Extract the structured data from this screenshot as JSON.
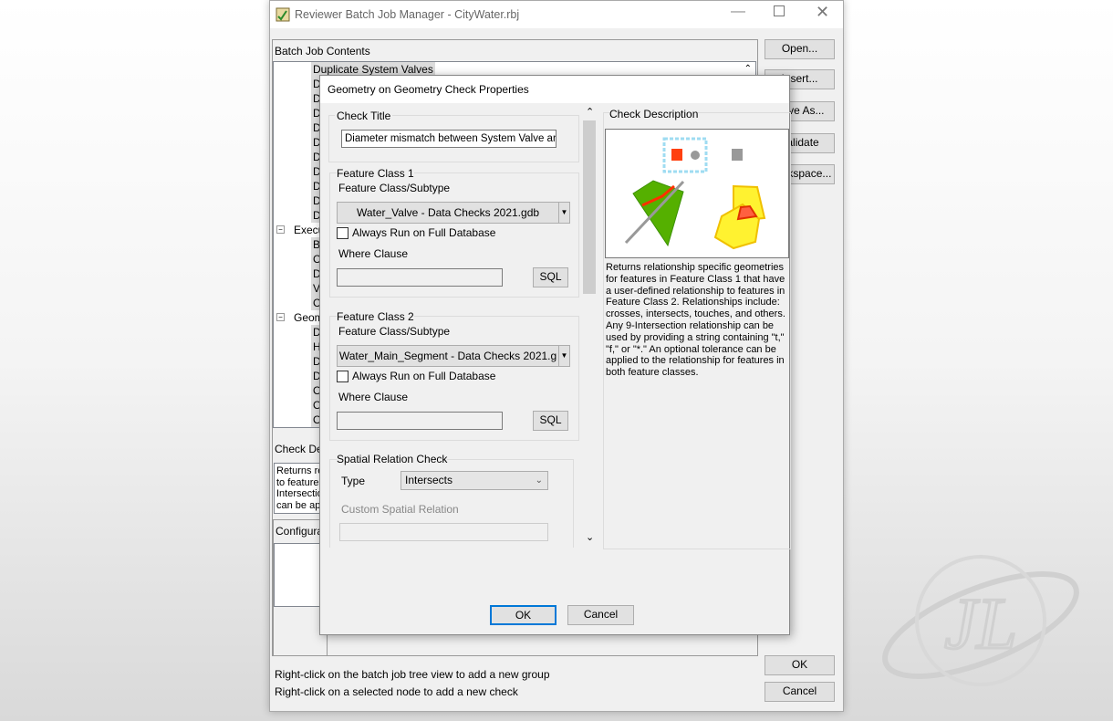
{
  "main_window": {
    "title": "Reviewer Batch Job Manager - CityWater.rbj",
    "batch_job_contents_label": "Batch Job Contents",
    "tree": {
      "selected": "Duplicate System Valves",
      "items": [
        "Du",
        "Du",
        "Du",
        "Du",
        "Du",
        "Du",
        "Du",
        "Du",
        "Du",
        "Du"
      ],
      "groups": [
        {
          "label": "Execu",
          "children": [
            "Bu",
            "Ci",
            "Di",
            "Va",
            "Cu"
          ]
        },
        {
          "label": "Geom",
          "children": [
            "De",
            "Hy",
            "Di",
            "Di",
            "Ov",
            "Ov",
            "Ov"
          ]
        }
      ]
    },
    "check_description_label": "Check De",
    "check_description_lines": [
      "Returns re",
      "to features",
      "Intersectio",
      "can be ap"
    ],
    "configuration_label": "Configurat",
    "buttons": {
      "open": "Open...",
      "insert": "Insert...",
      "save_as": "Save As...",
      "validate": "Validate",
      "workspace": "Workspace...",
      "ok": "OK",
      "cancel": "Cancel"
    },
    "hints": [
      "Right-click on the batch job tree view to add a new group",
      "Right-click on a selected node to add a new check"
    ]
  },
  "dialog": {
    "title": "Geometry on Geometry Check Properties",
    "check_title_label": "Check Title",
    "check_title_value": "Diameter mismatch between System Valve and M",
    "fc1": {
      "label": "Feature Class 1",
      "subtype_label": "Feature Class/Subtype",
      "value": "Water_Valve -  Data Checks 2021.gdb",
      "always_run": "Always Run on Full Database",
      "always_run_checked": false,
      "where_label": "Where Clause",
      "where_value": "",
      "sql": "SQL"
    },
    "fc2": {
      "label": "Feature Class 2",
      "subtype_label": "Feature Class/Subtype",
      "value": "Water_Main_Segment -  Data Checks 2021.g",
      "always_run": "Always Run on Full Database",
      "always_run_checked": false,
      "where_label": "Where Clause",
      "where_value": "",
      "sql": "SQL"
    },
    "spatial": {
      "label": "Spatial Relation Check",
      "type_label": "Type",
      "type_value": "Intersects",
      "custom_label": "Custom Spatial Relation",
      "custom_value": ""
    },
    "description_label": "Check Description",
    "description_text": "Returns relationship specific geometries for features in Feature Class 1 that have a user-defined relationship to features in Feature Class 2.  Relationships include: crosses, intersects, touches, and others. Any 9-Intersection relationship can be used by providing a string containing \"t,\" \"f,\" or \"*.\"  An optional tolerance can be applied to the relationship for features in both feature classes.",
    "ok": "OK",
    "cancel": "Cancel"
  },
  "colors": {
    "accent": "#0078d7",
    "selection": "#dcdcdc"
  }
}
